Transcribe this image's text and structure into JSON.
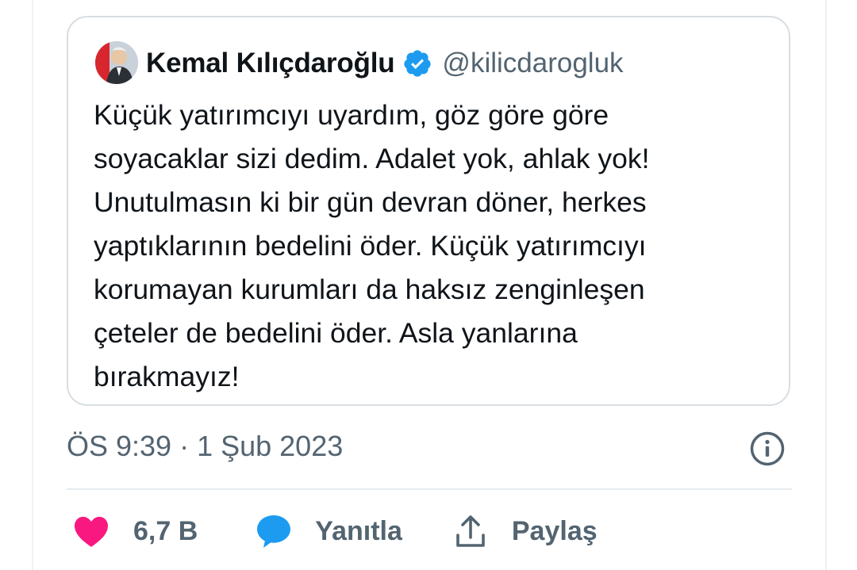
{
  "quoted_tweet": {
    "author_name": "Kemal Kılıçdaroğlu",
    "handle": "@kilicdarogluk",
    "verified": true,
    "text": "Küçük yatırımcıyı uyardım, göz göre göre\nsoyacaklar sizi dedim. Adalet yok, ahlak yok!\nUnutulmasın ki bir gün devran döner, herkes\nyaptıklarının bedelini öder. Küçük yatırımcıyı\nkorumayan kurumları da haksız zenginleşen\nçeteler de bedelini öder. Asla yanlarına\nbırakmayız!"
  },
  "meta": {
    "timestamp": "ÖS 9:39 · 1 Şub 2023"
  },
  "actions": {
    "like_count": "6,7 B",
    "reply_label": "Yanıtla",
    "share_label": "Paylaş"
  },
  "icons": {
    "avatar": "avatar",
    "verified": "verified-badge-icon",
    "info": "info-icon",
    "like": "heart-icon",
    "reply": "reply-bubble-icon",
    "share": "share-icon"
  },
  "colors": {
    "like": "#f91880",
    "reply": "#1d9bf0",
    "verified": "#1d9bf0",
    "secondary_text": "#536471"
  }
}
